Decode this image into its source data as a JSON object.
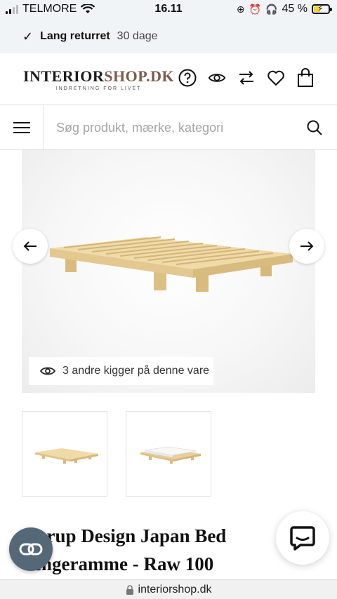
{
  "status_bar": {
    "carrier": "TELMORE",
    "time": "16.11",
    "battery_percent": "45 %",
    "battery_level": 0.45
  },
  "promo": {
    "bold_text": "Lang returret",
    "detail_text": "30 dage"
  },
  "header": {
    "logo_text_main": "INTERIOR",
    "logo_text_accent": "SHOP.DK",
    "logo_tagline": "INDRETNING FOR LIVET",
    "icons": [
      "help-icon",
      "eye-icon",
      "compare-icon",
      "heart-icon",
      "bag-icon"
    ]
  },
  "search": {
    "placeholder": "Søg produkt, mærke, kategori"
  },
  "gallery": {
    "viewers_text": "3 andre kigger på denne vare"
  },
  "product": {
    "title_line1": "Karup Design Japan Bed",
    "title_line2": "Sengeramme - Raw 100"
  },
  "browser": {
    "url": "interiorshop.dk"
  },
  "colors": {
    "accent": "#7d5b4d",
    "fab": "#546877",
    "wood": "#e8cf9a"
  }
}
